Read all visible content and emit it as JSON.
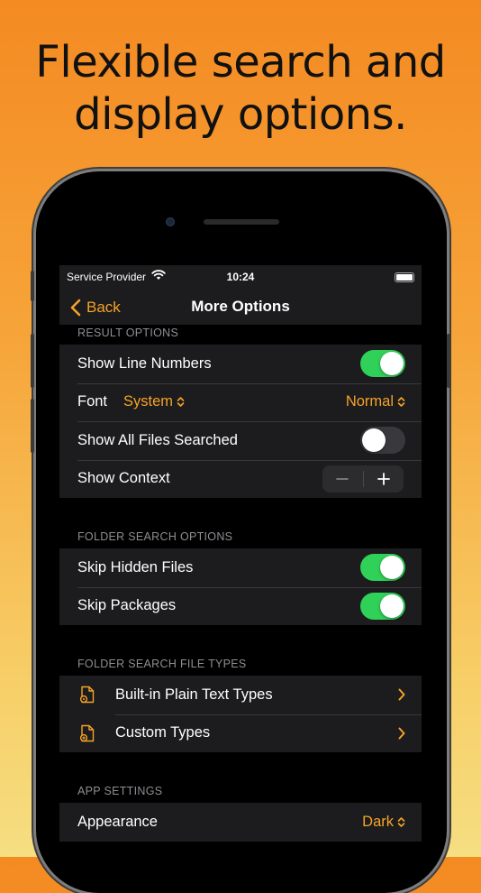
{
  "headline": {
    "line1": "Flexible search and",
    "line2": "display options."
  },
  "status_bar": {
    "carrier": "Service Provider",
    "time": "10:24"
  },
  "nav": {
    "back_label": "Back",
    "title": "More Options"
  },
  "sections": {
    "result": {
      "header": "RESULT OPTIONS",
      "show_line_numbers": {
        "label": "Show Line Numbers",
        "on": true
      },
      "font": {
        "label": "Font",
        "family": "System",
        "weight": "Normal"
      },
      "show_all_files": {
        "label": "Show All Files Searched",
        "on": false
      },
      "show_context": {
        "label": "Show Context",
        "minus": "−",
        "plus": "+"
      }
    },
    "folder": {
      "header": "FOLDER SEARCH OPTIONS",
      "skip_hidden": {
        "label": "Skip Hidden Files",
        "on": true
      },
      "skip_packages": {
        "label": "Skip Packages",
        "on": true
      }
    },
    "file_types": {
      "header": "FOLDER SEARCH FILE TYPES",
      "builtin": {
        "label": "Built-in Plain Text Types",
        "icon": "document-gear-icon"
      },
      "custom": {
        "label": "Custom Types",
        "icon": "document-plus-icon"
      }
    },
    "app": {
      "header": "APP SETTINGS",
      "appearance": {
        "label": "Appearance",
        "value": "Dark"
      }
    }
  },
  "colors": {
    "accent": "#f5a327",
    "toggle_on": "#30d158",
    "toggle_off": "#39393d",
    "cell_bg": "#1c1c1e",
    "background_top": "#f48a22",
    "background_bottom": "#f6de82"
  }
}
